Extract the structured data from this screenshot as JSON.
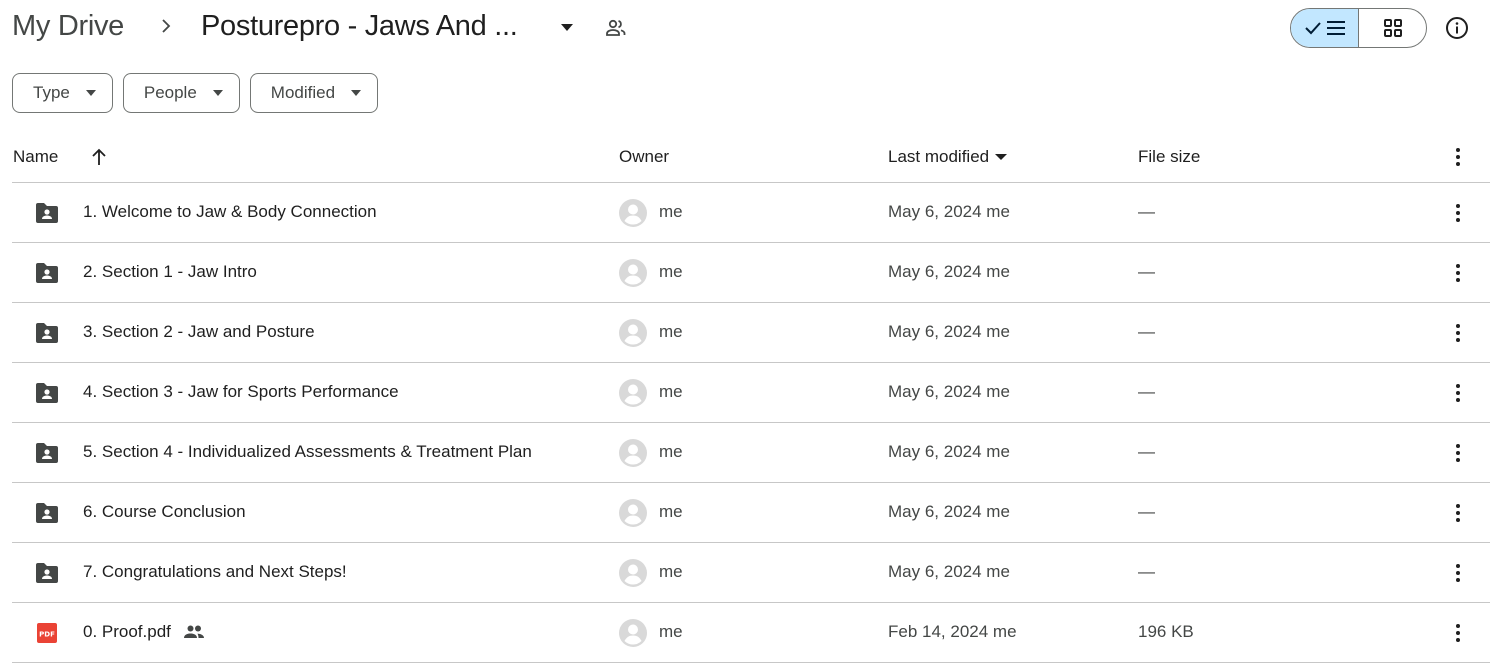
{
  "breadcrumb": {
    "root": "My Drive",
    "current": "Posturepro - Jaws And ..."
  },
  "view_toggle": {
    "active": "list",
    "list_icon": "checkmark-list-icon",
    "grid_icon": "grid-icon"
  },
  "icons": {
    "info": "info-icon",
    "shared_folder": "shared-folder-icon",
    "pdf": "pdf-icon",
    "shared": "people-icon",
    "avatar": "default-avatar-icon",
    "more": "more-vert-icon"
  },
  "filters": [
    {
      "label": "Type"
    },
    {
      "label": "People"
    },
    {
      "label": "Modified"
    }
  ],
  "columns": {
    "name": "Name",
    "owner": "Owner",
    "last_modified": "Last modified",
    "file_size": "File size"
  },
  "sort": {
    "column": "Name",
    "direction": "ascending"
  },
  "colors": {
    "accent_selected": "#c2e7ff",
    "folder": "#444746",
    "pdf": "#ea4335",
    "divider": "#c7c7c7"
  },
  "files": [
    {
      "type": "folder",
      "name": "1. Welcome to Jaw & Body Connection",
      "owner": "me",
      "modified": "May 6, 2024",
      "modified_by": "me",
      "size": "—",
      "shared": false
    },
    {
      "type": "folder",
      "name": "2. Section 1 - Jaw Intro",
      "owner": "me",
      "modified": "May 6, 2024",
      "modified_by": "me",
      "size": "—",
      "shared": false
    },
    {
      "type": "folder",
      "name": "3. Section 2 - Jaw and Posture",
      "owner": "me",
      "modified": "May 6, 2024",
      "modified_by": "me",
      "size": "—",
      "shared": false
    },
    {
      "type": "folder",
      "name": "4. Section 3 - Jaw for Sports Performance",
      "owner": "me",
      "modified": "May 6, 2024",
      "modified_by": "me",
      "size": "—",
      "shared": false
    },
    {
      "type": "folder",
      "name": "5. Section 4 - Individualized Assessments & Treatment Plan",
      "owner": "me",
      "modified": "May 6, 2024",
      "modified_by": "me",
      "size": "—",
      "shared": false
    },
    {
      "type": "folder",
      "name": "6. Course Conclusion",
      "owner": "me",
      "modified": "May 6, 2024",
      "modified_by": "me",
      "size": "—",
      "shared": false
    },
    {
      "type": "folder",
      "name": "7. Congratulations and Next Steps!",
      "owner": "me",
      "modified": "May 6, 2024",
      "modified_by": "me",
      "size": "—",
      "shared": false
    },
    {
      "type": "pdf",
      "name": "0. Proof.pdf",
      "owner": "me",
      "modified": "Feb 14, 2024",
      "modified_by": "me",
      "size": "196 KB",
      "shared": true
    }
  ]
}
